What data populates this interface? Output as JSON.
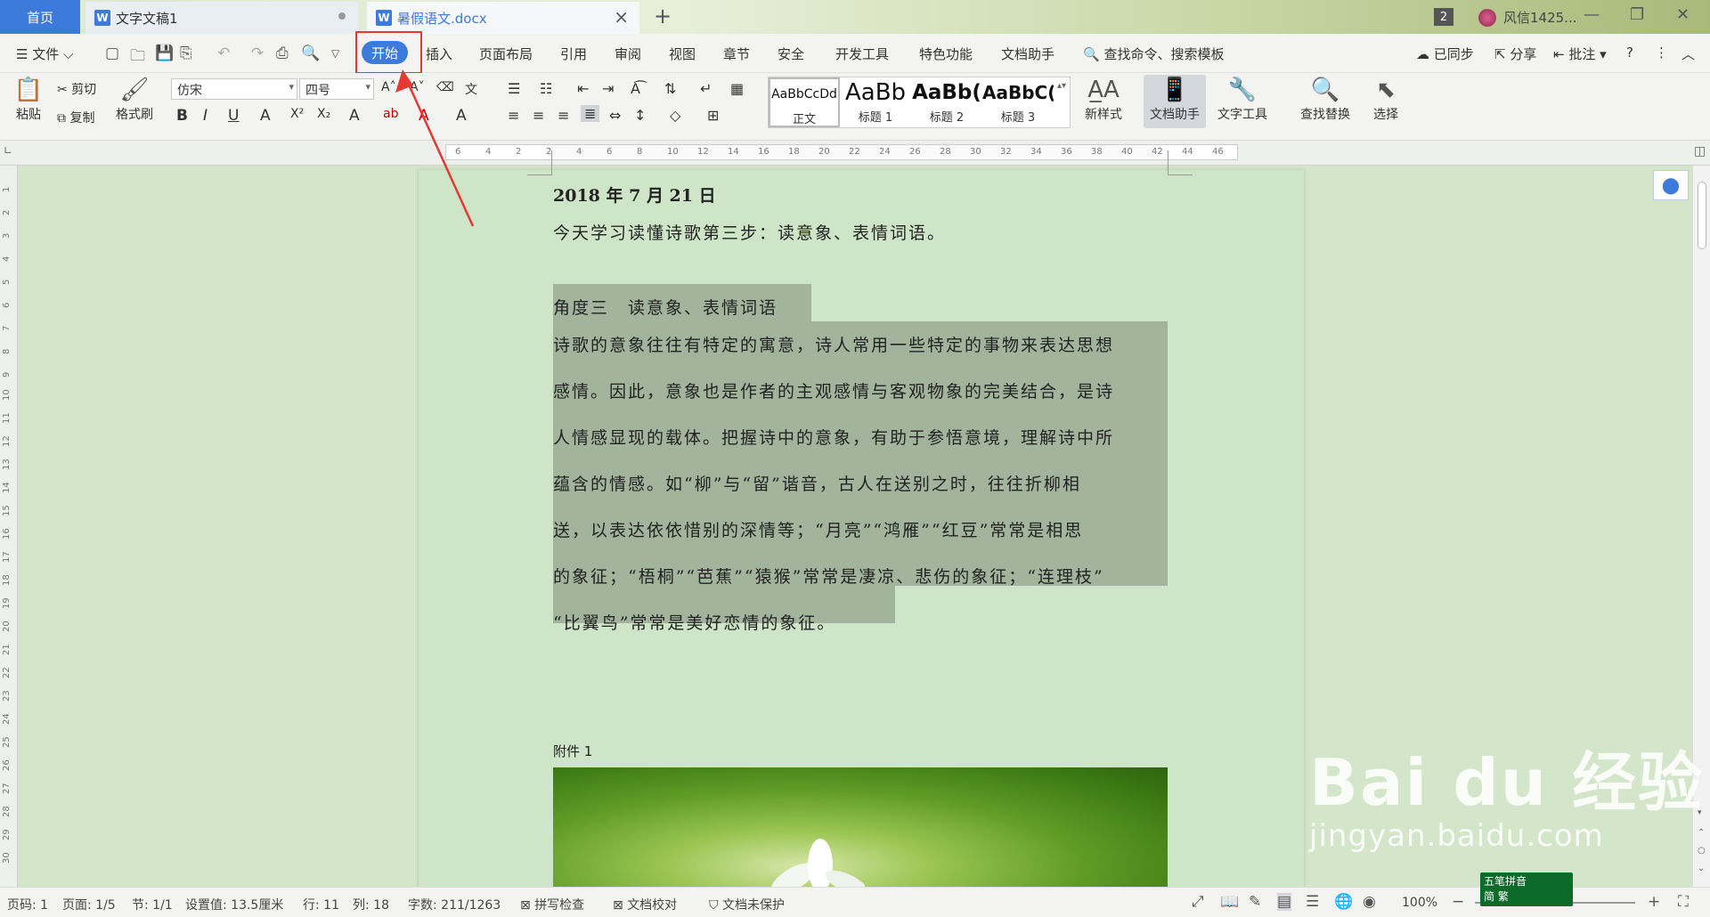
{
  "titlebar": {
    "home_tab": "首页",
    "tabs": [
      {
        "label": "文字文稿1",
        "icon": "W"
      },
      {
        "label": "暑假语文.docx",
        "icon": "W"
      }
    ],
    "new_tab": "+",
    "window_count": "2",
    "user_name": "风信1425..."
  },
  "menubar": {
    "file": "文件",
    "start": "开始",
    "items": [
      "插入",
      "页面布局",
      "引用",
      "审阅",
      "视图",
      "章节",
      "安全",
      "开发工具",
      "特色功能",
      "文档助手"
    ],
    "search": "查找命令、搜索模板",
    "sync": "已同步",
    "share": "分享",
    "comment": "批注",
    "help": "?"
  },
  "ribbon": {
    "paste": "粘贴",
    "cut": "剪切",
    "copy": "复制",
    "format_painter": "格式刷",
    "font_name": "仿宋",
    "font_size": "四号",
    "styles": [
      {
        "preview": "AaBbCcDd",
        "caption": "正文"
      },
      {
        "preview": "AaBb",
        "caption": "标题 1"
      },
      {
        "preview": "AaBb(",
        "caption": "标题 2"
      },
      {
        "preview": "AaBbC(",
        "caption": "标题 3"
      }
    ],
    "new_style": "新样式",
    "doc_assistant": "文档助手",
    "text_tools": "文字工具",
    "find_replace": "查找替换",
    "select": "选择"
  },
  "ruler_labels": [
    "6",
    "4",
    "2",
    "2",
    "4",
    "6",
    "8",
    "10",
    "12",
    "14",
    "16",
    "18",
    "20",
    "22",
    "24",
    "26",
    "28",
    "30",
    "32",
    "34",
    "36",
    "38",
    "40",
    "42",
    "44",
    "46"
  ],
  "vruler_labels": [
    "1",
    "2",
    "3",
    "4",
    "5",
    "6",
    "7",
    "8",
    "9",
    "10",
    "11",
    "12",
    "13",
    "14",
    "15",
    "16",
    "17",
    "18",
    "19",
    "20",
    "21",
    "22",
    "23",
    "24",
    "25",
    "26",
    "27",
    "28",
    "29",
    "30"
  ],
  "document": {
    "date": "2018 年 7 月 21 日",
    "intro": "今天学习读懂诗歌第三步：读意象、表情词语。",
    "heading": "角度三　读意象、表情词语",
    "lines": [
      "诗歌的意象往往有特定的寓意，诗人常用一些特定的事物来表达思想",
      "感情。因此，意象也是作者的主观感情与客观物象的完美结合，是诗",
      "人情感显现的载体。把握诗中的意象，有助于参悟意境，理解诗中所",
      "蕴含的情感。如“柳”与“留”谐音，古人在送别之时，往往折柳相",
      "送，以表达依依惜别的深情等；“月亮”“鸿雁”“红豆”常常是相思",
      "的象征；“梧桐”“芭蕉”“猿猴”常常是凄凉、悲伤的象征；“连理枝”",
      "“比翼鸟”常常是美好恋情的象征。"
    ],
    "attachment": "附件 1"
  },
  "statusbar": {
    "page_num": "页码: 1",
    "pages": "页面: 1/5",
    "section": "节: 1/1",
    "setting": "设置值: 13.5厘米",
    "row": "行: 11",
    "col": "列: 18",
    "words": "字数: 211/1263",
    "spell": "拼写检查",
    "proof": "文档校对",
    "protect": "文档未保护",
    "zoom": "100%"
  },
  "ime": {
    "line1": "五笔拼音",
    "line2": "简 繁"
  },
  "watermark": {
    "brand": "Bai du 经验",
    "url": "jingyan.baidu.com"
  },
  "colors": {
    "accent": "#3c7bd9",
    "annotation": "#e53935",
    "page_bg": "#cee5c7",
    "selection": "#a2b49c"
  }
}
